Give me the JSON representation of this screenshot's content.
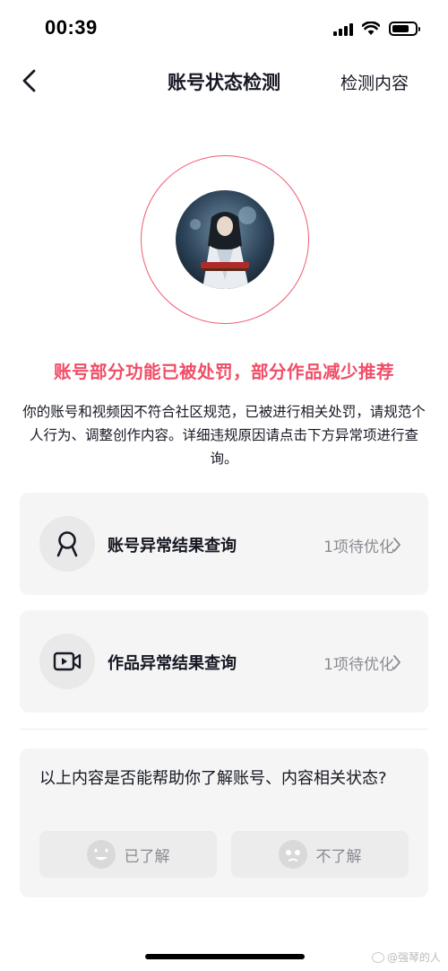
{
  "status_bar": {
    "time": "00:39"
  },
  "nav": {
    "title": "账号状态检测",
    "action": "检测内容"
  },
  "status": {
    "headline": "账号部分功能已被处罚，部分作品减少推荐",
    "description": "你的账号和视频因不符合社区规范，已被进行相关处罚，请规范个人行为、调整创作内容。详细违规原因请点击下方异常项进行查询。"
  },
  "cards": [
    {
      "title": "账号异常结果查询",
      "meta": "1项待优化",
      "icon": "user-icon"
    },
    {
      "title": "作品异常结果查询",
      "meta": "1项待优化",
      "icon": "video-icon"
    }
  ],
  "feedback": {
    "question": "以上内容是否能帮助你了解账号、内容相关状态?",
    "yes_label": "已了解",
    "no_label": "不了解"
  },
  "watermark": "@强琴的人",
  "colors": {
    "accent": "#f04d66",
    "card_bg": "#f5f5f5",
    "muted": "#8a8b91"
  }
}
